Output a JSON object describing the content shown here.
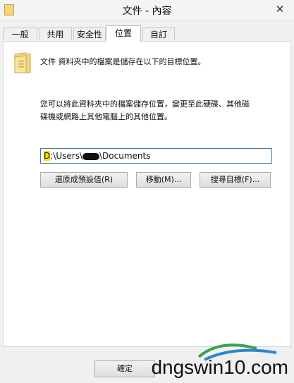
{
  "window": {
    "title": "文件 - 內容",
    "close_glyph": "✕"
  },
  "tabs": [
    {
      "label": "一般"
    },
    {
      "label": "共用"
    },
    {
      "label": "安全性"
    },
    {
      "label": "位置"
    },
    {
      "label": "自訂"
    }
  ],
  "active_tab": "位置",
  "location": {
    "description": "文件 資料夾中的檔案是儲存在以下的目標位置。",
    "info_line1": "您可以將此資料夾中的檔案儲存位置，變更至此硬碟、其他磁",
    "info_line2": "碟機或網路上其他電腦上的其他位置。",
    "path_highlight": "D",
    "path_rest": ":\\Users\\",
    "path_redacted": "",
    "path_tail": "\\Documents"
  },
  "buttons": {
    "restore_default": "還原成預設值(R)",
    "move": "移動(M)...",
    "find_target": "搜尋目標(F)..."
  },
  "footer": {
    "ok": "確定"
  },
  "watermark": {
    "text": "dngswin10.com"
  },
  "icons": {
    "folder": "folder-icon",
    "app": "folder-app-icon"
  },
  "colors": {
    "tab_active_bg": "#ffffff",
    "input_border": "#3c7fb1",
    "folder_fill": "#f5d57a"
  }
}
